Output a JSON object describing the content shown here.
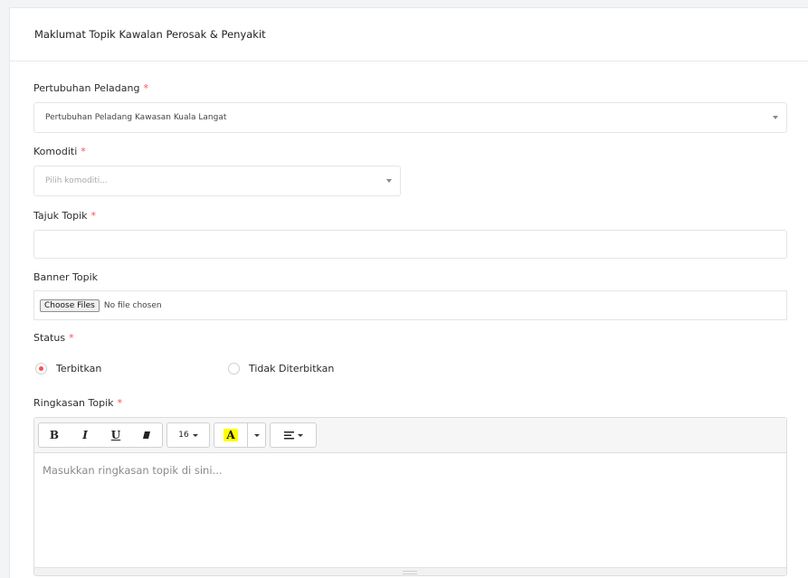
{
  "card": {
    "title": "Maklumat Topik Kawalan Perosak & Penyakit"
  },
  "required_mark": "*",
  "organisation": {
    "label": "Pertubuhan Peladang",
    "selected": "Pertubuhan Peladang Kawasan Kuala Langat"
  },
  "commodity": {
    "label": "Komoditi",
    "placeholder": "Pilih komoditi..."
  },
  "topic_title": {
    "label": "Tajuk Topik",
    "value": ""
  },
  "banner": {
    "label": "Banner Topik",
    "button": "Choose Files",
    "status": "No file chosen"
  },
  "status": {
    "label": "Status",
    "options": [
      {
        "label": "Terbitkan",
        "selected": true
      },
      {
        "label": "Tidak Diterbitkan",
        "selected": false
      }
    ]
  },
  "summary": {
    "label": "Ringkasan Topik",
    "placeholder": "Masukkan ringkasan topik di sini...",
    "toolbar": {
      "bold": "B",
      "italic": "I",
      "underline": "U",
      "eraser": "eraser-icon",
      "font_size": "16",
      "text_color": "A",
      "highlight_color": "#ffff00",
      "align": "align-left-icon"
    }
  },
  "colors": {
    "accent": "#ff4d4f"
  }
}
